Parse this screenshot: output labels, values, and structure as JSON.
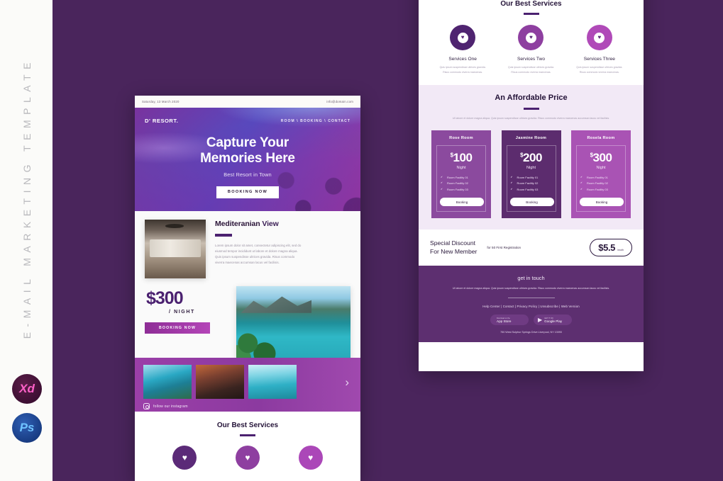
{
  "sidebar": {
    "vertical_title": "E-MAIL MARKETING TEMPLATE",
    "badges": [
      {
        "name": "adobe-xd",
        "label": "Xd"
      },
      {
        "name": "adobe-photoshop",
        "label": "Ps"
      }
    ]
  },
  "left_panel": {
    "topbar": {
      "date": "Saturday, 13 March 2020",
      "email": "info@domain.com"
    },
    "hero": {
      "brand": "D' RESORT.",
      "nav": "ROOM \\ BOOKING \\ CONTACT",
      "title_line1": "Capture Your",
      "title_line2": "Memories Here",
      "subtitle": "Best Resort in Town",
      "button": "BOOKING NOW"
    },
    "feature": {
      "title_bold": "Mediteranian",
      "title_light": "View",
      "body": "Lorem ipsum dolor sit amet, consectetur adipiscing elit, sed do eiusmod tempor incididunt ut labore et dolore magna aliqua. Quis ipsum suspendisse ultrices gravida. Risus commodo viverra maecenas accumsan lacus vel facilisis.",
      "price": "$300",
      "price_unit": "/ NIGHT",
      "button": "BOOKING NOW"
    },
    "gallery": {
      "instagram_label": "follow our instagram",
      "arrow": "›"
    },
    "services": {
      "title": "Our Best Services",
      "circle_colors": [
        "#5b2a78",
        "#8e3fa0",
        "#ab47b8"
      ]
    }
  },
  "right_panel": {
    "services": {
      "title": "Our Best Services",
      "items": [
        {
          "name": "Services One",
          "desc": "Quis ipsum suspendisse ultrices gravida. Risus commodo viverra maecenas.",
          "color": "#4f2470"
        },
        {
          "name": "Services Two",
          "desc": "Quis ipsum suspendisse ultrices gravida. Risus commodo viverra maecenas.",
          "color": "#8e3fa0"
        },
        {
          "name": "Services Three",
          "desc": "Quis ipsum suspendisse ultrices gravida. Risus commodo viverra maecenas.",
          "color": "#b04ab8"
        }
      ],
      "icon": "♥"
    },
    "pricing": {
      "title": "An Affordable Price",
      "subtitle": "Ut labore et dolore magna aliqua. Quis ipsum suspendisse ultrices gravida. Risus commodo viverra maecenas accumsan lacus vel facilisis.",
      "plans": [
        {
          "name": "Rose Room",
          "currency": "$",
          "amount": "100",
          "unit": "Night",
          "features": [
            "Room Facility 01",
            "Room Facility 02",
            "Room Facility 03"
          ],
          "button": "Booking"
        },
        {
          "name": "Jasmine Room",
          "currency": "$",
          "amount": "200",
          "unit": "Night",
          "features": [
            "Room Facility 01",
            "Room Facility 02",
            "Room Facility 03"
          ],
          "button": "Booking"
        },
        {
          "name": "Rosela Room",
          "currency": "$",
          "amount": "300",
          "unit": "Night",
          "features": [
            "Room Facility 01",
            "Room Facility 02",
            "Room Facility 03"
          ],
          "button": "Booking"
        }
      ]
    },
    "discount": {
      "heading_line1": "Special Discount",
      "heading_line2": "For New Member",
      "registration": "for 50  First Registration",
      "price": "$5.5",
      "period": "/moth"
    },
    "footer": {
      "title": "get in touch",
      "lead": "Ut labore et dolore magna aliqua. Quis ipsum suspendisse ultrices gravida. Risus commodo viverra maecenas accumsan lacus vel facilisis.",
      "links": "Help Center | Contact | Privacy Policy | Unsubscribe | Web Version",
      "stores": [
        {
          "small": "Download on the",
          "big": "App Store",
          "glyph": ""
        },
        {
          "small": "GET IT ON",
          "big": "Google Play",
          "glyph": "▶"
        }
      ],
      "address": "750 West Sulphur Springs Drive Liverpool, NY 13090"
    }
  },
  "theme": {
    "background": "#4a255c",
    "accent_purple": "#4b2170",
    "magenta": "#a949b4"
  }
}
